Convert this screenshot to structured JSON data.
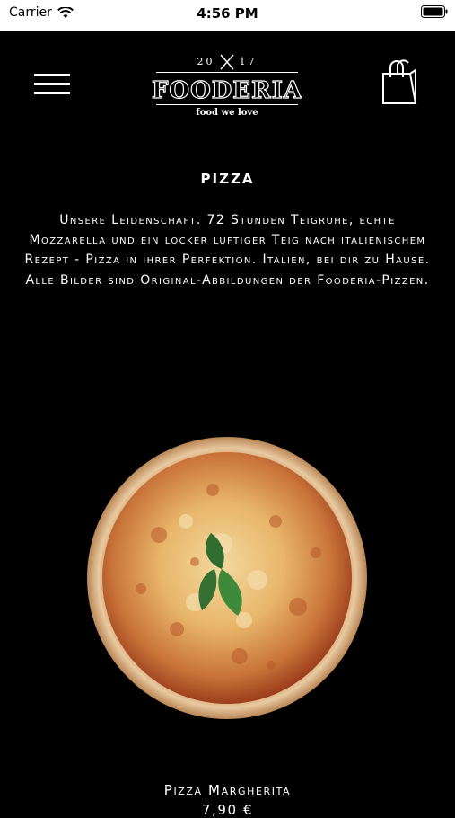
{
  "status_bar": {
    "carrier": "Carrier",
    "time": "4:56 PM"
  },
  "header": {
    "logo_year_left": "20",
    "logo_year_right": "17",
    "logo_name": "FOODERIA",
    "logo_tagline": "food we love"
  },
  "section": {
    "title": "PIZZA",
    "description": "Unsere Leidenschaft. 72 Stunden Teigruhe, echte Mozzarella und ein locker luftiger Teig nach italienischem Rezept - Pizza in ihrer Perfektion. Italien, bei dir zu Hause. Alle Bilder sind Original-Abbildungen der Fooderia-Pizzen."
  },
  "product": {
    "name": "Pizza Margherita",
    "price": "7,90 €"
  },
  "colors": {
    "background": "#000000",
    "text": "#ffffff",
    "status_bar": "#ffffff"
  }
}
